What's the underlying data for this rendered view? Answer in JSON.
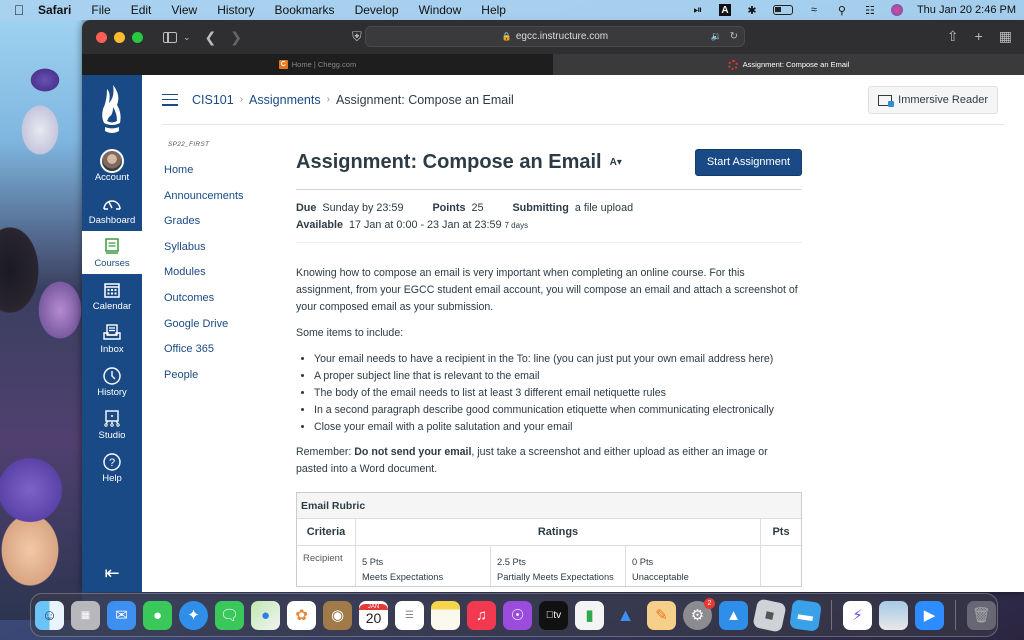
{
  "menubar": {
    "app_name": "Safari",
    "menus": [
      "File",
      "Edit",
      "View",
      "History",
      "Bookmarks",
      "Develop",
      "Window",
      "Help"
    ],
    "clock": "Thu Jan 20  2:46 PM",
    "input_source": "A"
  },
  "browser": {
    "url": "egcc.instructure.com",
    "tabs": [
      {
        "title": "Home | Chegg.com",
        "favicon": "chegg-c-icon",
        "active": false
      },
      {
        "title": "Assignment: Compose an Email",
        "favicon": "canvas-icon",
        "active": true
      }
    ]
  },
  "global_nav": {
    "items": [
      {
        "label": "Account",
        "icon": "avatar"
      },
      {
        "label": "Dashboard",
        "icon": "dashboard-gauge-icon"
      },
      {
        "label": "Courses",
        "icon": "book-icon",
        "active": true
      },
      {
        "label": "Calendar",
        "icon": "calendar-icon"
      },
      {
        "label": "Inbox",
        "icon": "inbox-icon"
      },
      {
        "label": "History",
        "icon": "clock-icon"
      },
      {
        "label": "Studio",
        "icon": "studio-icon"
      },
      {
        "label": "Help",
        "icon": "help-icon"
      }
    ],
    "accent": "#1a4a85"
  },
  "breadcrumb": {
    "items": [
      "CIS101",
      "Assignments",
      "Assignment: Compose an Email"
    ]
  },
  "immersive_reader_label": "Immersive Reader",
  "course_nav": {
    "term": "SP22_FIRST",
    "links": [
      "Home",
      "Announcements",
      "Grades",
      "Syllabus",
      "Modules",
      "Outcomes",
      "Google Drive",
      "Office 365",
      "People"
    ]
  },
  "assignment": {
    "title": "Assignment: Compose an Email",
    "start_button": "Start Assignment",
    "due_label": "Due",
    "due_value": "Sunday by 23:59",
    "points_label": "Points",
    "points_value": "25",
    "submitting_label": "Submitting",
    "submitting_value": "a file upload",
    "available_label": "Available",
    "available_value": "17 Jan at 0:00 - 23 Jan at 23:59",
    "available_duration": "7 days",
    "intro": "Knowing how to compose an email is very important when completing an online course.  For this assignment, from your EGCC student email account, you will compose an email and attach a screenshot of your composed email as your submission.",
    "items_heading": "Some items to include:",
    "items": [
      "Your email needs to have a recipient in the To: line (you can just put your own email address here)",
      "A proper subject line that is relevant to the email",
      "The body of the email needs to list at least 3 different email netiquette rules",
      "In a second paragraph describe good communication etiquette when communicating electronically",
      "Close your email with a polite salutation and your email"
    ],
    "remember_prefix": "Remember: ",
    "remember_bold": "Do not send your email",
    "remember_suffix": ", just take a screenshot and either upload as either an image or pasted into a Word document."
  },
  "rubric": {
    "title": "Email Rubric",
    "headers": {
      "criteria": "Criteria",
      "ratings": "Ratings",
      "pts": "Pts"
    },
    "rows": [
      {
        "criterion": "Recipient",
        "ratings": [
          {
            "points": "5 Pts",
            "label": "Meets Expectations"
          },
          {
            "points": "2.5 Pts",
            "label": "Partially Meets Expectations"
          },
          {
            "points": "0 Pts",
            "label": "Unacceptable"
          }
        ]
      }
    ]
  },
  "dock": {
    "apps": [
      "Finder",
      "Launchpad",
      "Mail",
      "FaceTime",
      "Safari",
      "Messages",
      "Maps",
      "Photos",
      "Contacts",
      "Calendar",
      "Reminders",
      "Notes",
      "Music",
      "Podcasts",
      "TV",
      "Numbers",
      "Keynote",
      "Pages",
      "System Preferences",
      "App Store",
      "Roblox",
      "Roblox Studio",
      "Messenger",
      "Preview",
      "Zoom",
      "Trash"
    ],
    "calendar_month": "JAN",
    "calendar_day": "20",
    "system_prefs_badge": "2",
    "tv_label": "tv"
  }
}
